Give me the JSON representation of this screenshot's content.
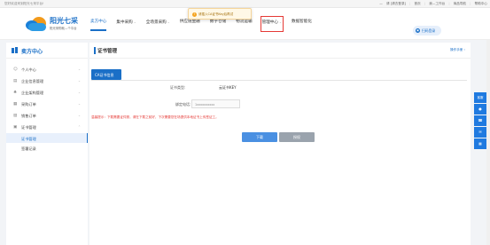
{
  "topbar": {
    "welcome": "您好欢迎来到阳光七采平台!",
    "user_sep": "—",
    "user_hint": "请 [请去登录]",
    "links": [
      "首页",
      "我—工作台",
      "商品导航",
      "帮助中心"
    ]
  },
  "brand": {
    "title": "阳光七采",
    "subtitle": "阳光采购就—个平台"
  },
  "nav": {
    "items": [
      {
        "label": "卖方中心",
        "active": true,
        "dropdown": false
      },
      {
        "label": "集中采购",
        "active": false,
        "dropdown": true
      },
      {
        "label": "全场景采购",
        "active": false,
        "dropdown": true
      },
      {
        "label": "供应链金融",
        "active": false,
        "dropdown": false
      },
      {
        "label": "数字仓储",
        "active": false,
        "dropdown": false
      },
      {
        "label": "物流运输",
        "active": false,
        "dropdown": false
      },
      {
        "label": "管理中心",
        "active": false,
        "dropdown": true,
        "boxed": true
      },
      {
        "label": "数据智能化",
        "active": false,
        "dropdown": false
      }
    ]
  },
  "toast": {
    "message": "请插入CA证书Key后再试"
  },
  "login": {
    "label": "扫码登录"
  },
  "sidebar": {
    "title": "卖方中心",
    "menu": [
      {
        "label": "个人中心",
        "icon": "user-icon",
        "chev": "⌄"
      },
      {
        "label": "企业信息管理",
        "icon": "building-icon",
        "chev": "⌄"
      },
      {
        "label": "企业架构管理",
        "icon": "org-icon",
        "chev": "⌄"
      },
      {
        "label": "采购订单",
        "icon": "order-icon",
        "chev": "⌄"
      },
      {
        "label": "销售订单",
        "icon": "sales-icon",
        "chev": "⌄"
      },
      {
        "label": "证书管理",
        "icon": "cert-icon",
        "chev": "⌃"
      }
    ],
    "submenu": [
      {
        "label": "证书管理",
        "active": true
      },
      {
        "label": "签署记录",
        "active": false
      }
    ]
  },
  "page": {
    "title": "证书管理",
    "help": "操作手册 ›",
    "tab": "CA证书信息",
    "cert_type_label": "证书类型:",
    "cert_type_value": "云证书KEY",
    "phone_label": "绑定电话:",
    "phone_value": "1xxxxxxxxxx",
    "warning": "温馨提示：下载需要证件照，请在下载之前好，下次需要您在场提供本地证书上传签证工。",
    "download_btn": "下载",
    "auth_btn": "授权"
  },
  "rail": {
    "items": [
      "客服",
      "●",
      "☎",
      "✉",
      "▦"
    ]
  }
}
